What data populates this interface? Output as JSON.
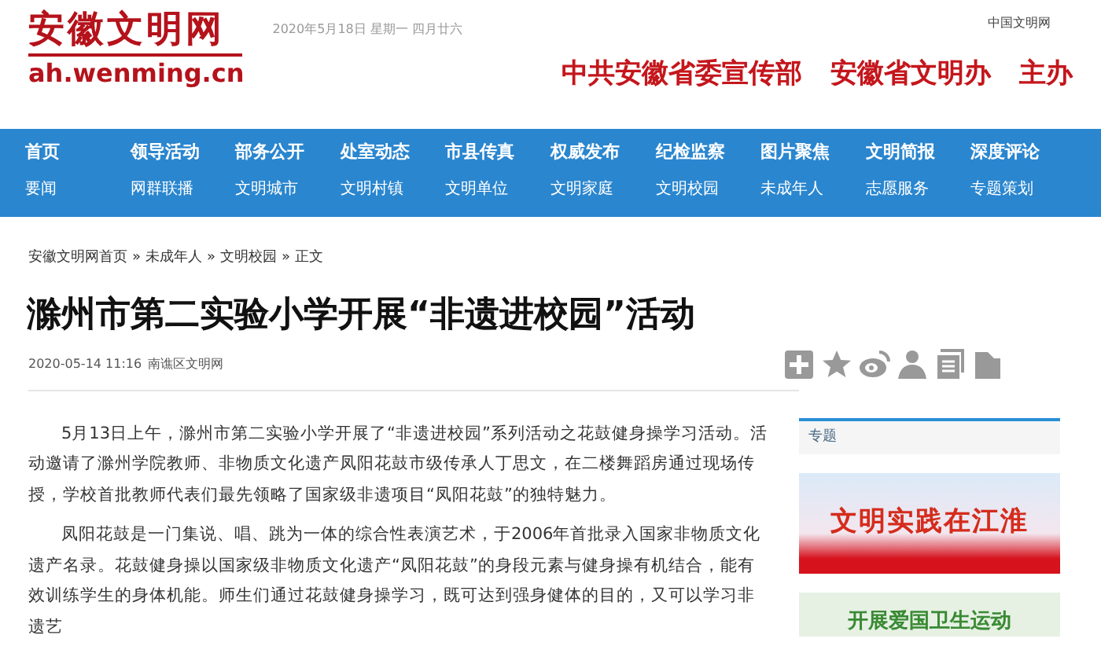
{
  "header": {
    "logo_title": "安徽文明网",
    "logo_url": "ah.wenming.cn",
    "date": "2020年5月18日  星期一  四月廿六",
    "top_link": "中国文明网",
    "sponsors": [
      "中共安徽省委宣传部",
      "安徽省文明办",
      "主办"
    ]
  },
  "nav": {
    "primary": [
      "首页",
      "领导活动",
      "部务公开",
      "处室动态",
      "市县传真",
      "权威发布",
      "纪检监察",
      "图片聚焦",
      "文明简报",
      "深度评论"
    ],
    "secondary": [
      "要闻",
      "网群联播",
      "文明城市",
      "文明村镇",
      "文明单位",
      "文明家庭",
      "文明校园",
      "未成年人",
      "志愿服务",
      "专题策划"
    ]
  },
  "breadcrumb": {
    "separator": "»",
    "items": [
      "安徽文明网首页",
      "未成年人",
      "文明校园",
      "正文"
    ]
  },
  "article": {
    "title": "滁州市第二实验小学开展“非遗进校园”活动",
    "date": "2020-05-14 11:16",
    "source": "南谯区文明网",
    "paragraphs": [
      "5月13日上午，滁州市第二实验小学开展了“非遗进校园”系列活动之花鼓健身操学习活动。活动邀请了滁州学院教师、非物质文化遗产凤阳花鼓市级传承人丁思文，在二楼舞蹈房通过现场传授，学校首批教师代表们最先领略了国家级非遗项目“凤阳花鼓”的独特魅力。",
      "凤阳花鼓是一门集说、唱、跳为一体的综合性表演艺术，于2006年首批录入国家非物质文化遗产名录。花鼓健身操以国家级非物质文化遗产“凤阳花鼓”的身段元素与健身操有机结合，能有效训练学生的身体机能。师生们通过花鼓健身操学习，既可达到强身健体的目的，又可以学习非遗艺"
    ]
  },
  "sidebar": {
    "heading": "专题",
    "banners": [
      "文明实践在江淮",
      "开展爱国卫生运动"
    ]
  }
}
